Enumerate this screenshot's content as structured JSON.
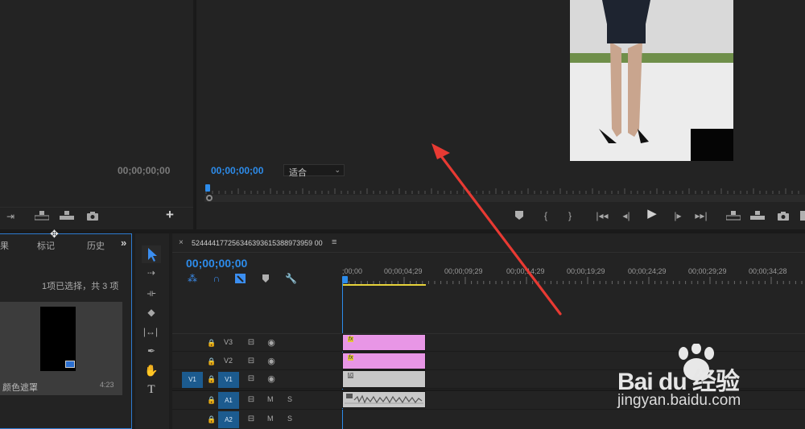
{
  "source_monitor": {
    "timecode": "00;00;00;00"
  },
  "program_monitor": {
    "timecode": "00;00;00;00",
    "fit": "适合"
  },
  "project_panel": {
    "tabs": [
      "果",
      "标记",
      "历史"
    ],
    "more": "»",
    "selection_info": "1项已选择，共 3 项",
    "item": {
      "name": "颜色遮罩",
      "duration": "4:23"
    }
  },
  "sequence": {
    "name": "524444177256346393615388973959 00",
    "close": "×",
    "menu": "≡",
    "timecode": "00;00;00;00",
    "ruler_labels": [
      ";00;00",
      "00;00;04;29",
      "00;00;09;29",
      "00;00;14;29",
      "00;00;19;29",
      "00;00;24;29",
      "00;00;29;29",
      "00;00;34;28"
    ],
    "tracks": [
      {
        "name": "V3",
        "source": ""
      },
      {
        "name": "V2",
        "source": ""
      },
      {
        "name": "V1",
        "source": "V1"
      },
      {
        "name": "A1",
        "source": "",
        "m": "M",
        "s": "S"
      },
      {
        "name": "A2",
        "source": "",
        "m": "M",
        "s": "S"
      }
    ],
    "fx_label": "fx"
  },
  "tools": [
    "selection-tool",
    "track-select-tool",
    "ripple-edit-tool",
    "razor-tool",
    "slip-tool",
    "pen-tool",
    "hand-tool",
    "type-tool"
  ],
  "type_tool_glyph": "T",
  "add_glyph": "+",
  "watermark": {
    "brand": "Bai du 经验",
    "url": "jingyan.baidu.com"
  },
  "colors": {
    "timecode": "#2d8ceb",
    "clip_pink": "#e896e6",
    "clip_gray": "#c8c8c8",
    "annotation_arrow": "#e83a33"
  }
}
